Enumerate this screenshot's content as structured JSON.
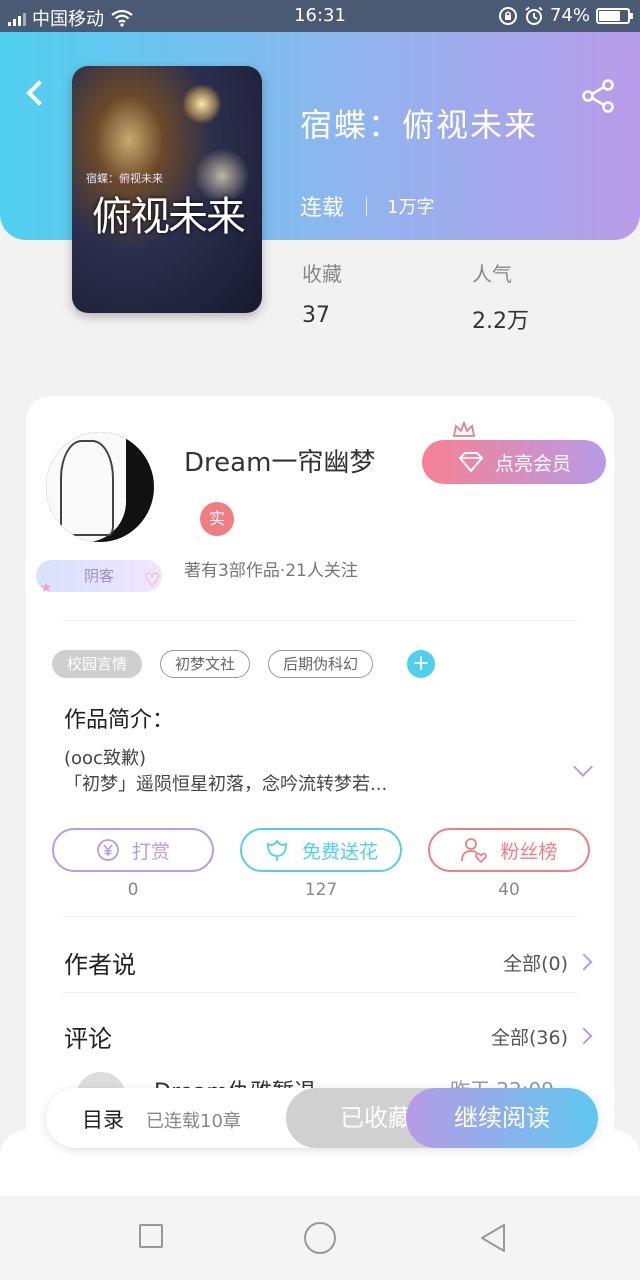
{
  "status_bar": {
    "carrier": "中国移动",
    "time": "16:31",
    "battery": "74%",
    "battery_level": 0.74
  },
  "book": {
    "title": "宿蝶：俯视未来",
    "status": "连载",
    "word_count": "1万字",
    "cover_title": "俯视未来",
    "cover_subtitle": "宿蝶：俯视未来"
  },
  "stats": [
    {
      "label": "收藏",
      "value": "37"
    },
    {
      "label": "人气",
      "value": "2.2万"
    }
  ],
  "author": {
    "name": "Dream一帘幽梦",
    "badge": "实",
    "vip_button": "点亮会员",
    "guest_badge": "阴客",
    "meta": "著有3部作品·21人关注"
  },
  "tags": [
    "校园言情",
    "初梦文社",
    "后期伪科幻"
  ],
  "intro": {
    "title": "作品简介：",
    "line1": "(ooc致歉)",
    "line2": "「初梦」遥陨恒星初落，念吟流转梦若..."
  },
  "actions": [
    {
      "label": "打赏",
      "count": "0",
      "color": "#b79be6"
    },
    {
      "label": "免费送花",
      "count": "127",
      "color": "#4fd0ef"
    },
    {
      "label": "粉丝榜",
      "count": "40",
      "color": "#f07d84"
    }
  ],
  "author_says": {
    "title": "作者说",
    "more": "全部(0)"
  },
  "comments": {
    "title": "评论",
    "more": "全部(36)",
    "first_name": "Dream仇雅暂退",
    "first_time": "昨天 22:09"
  },
  "bottom_bar": {
    "toc": "目录",
    "toc_meta": "已连载10章",
    "favorited": "已收藏",
    "continue": "继续阅读"
  }
}
